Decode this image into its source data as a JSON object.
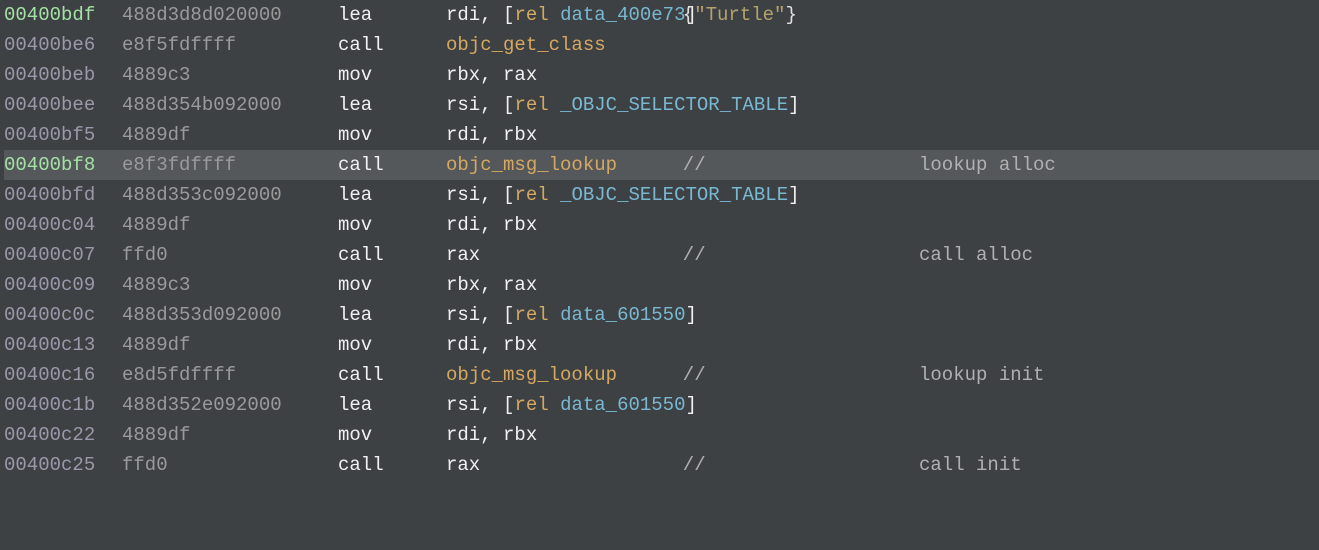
{
  "rows": [
    {
      "addr": "00400bdf",
      "addrClass": "addr",
      "bytes": "488d3d8d020000",
      "mnem": "lea",
      "ops": [
        {
          "t": "rdi",
          "c": "reg"
        },
        {
          "t": ", [",
          "c": "punct"
        },
        {
          "t": "rel",
          "c": "kw"
        },
        {
          "t": " ",
          "c": "punct"
        },
        {
          "t": "data_400e73",
          "c": "sym"
        },
        {
          "t": "]",
          "c": "punct"
        }
      ],
      "annot": [
        {
          "t": "  {",
          "c": "brace"
        },
        {
          "t": "\"Turtle\"",
          "c": "string"
        },
        {
          "t": "}",
          "c": "brace"
        }
      ]
    },
    {
      "addr": "00400be6",
      "addrClass": "addr-dim",
      "bytes": "e8f5fdffff",
      "mnem": "call",
      "ops": [
        {
          "t": "objc_get_class",
          "c": "callsym"
        }
      ]
    },
    {
      "addr": "00400beb",
      "addrClass": "addr-dim",
      "bytes": "4889c3",
      "mnem": "mov",
      "ops": [
        {
          "t": "rbx",
          "c": "reg"
        },
        {
          "t": ", ",
          "c": "punct"
        },
        {
          "t": "rax",
          "c": "reg"
        }
      ]
    },
    {
      "addr": "00400bee",
      "addrClass": "addr-dim",
      "bytes": "488d354b092000",
      "mnem": "lea",
      "ops": [
        {
          "t": "rsi",
          "c": "reg"
        },
        {
          "t": ", [",
          "c": "punct"
        },
        {
          "t": "rel",
          "c": "kw"
        },
        {
          "t": " ",
          "c": "punct"
        },
        {
          "t": "_OBJC_SELECTOR_TABLE",
          "c": "sym-selector"
        },
        {
          "t": "]",
          "c": "punct"
        }
      ]
    },
    {
      "addr": "00400bf5",
      "addrClass": "addr-dim",
      "bytes": "4889df",
      "mnem": "mov",
      "ops": [
        {
          "t": "rdi",
          "c": "reg"
        },
        {
          "t": ", ",
          "c": "punct"
        },
        {
          "t": "rbx",
          "c": "reg"
        }
      ]
    },
    {
      "addr": "00400bf8",
      "addrClass": "addr",
      "highlighted": true,
      "bytes": "e8f3fdffff",
      "mnem": "call",
      "ops": [
        {
          "t": "objc_msg_lookup",
          "c": "callsym"
        }
      ],
      "annot": [
        {
          "t": "  // ",
          "c": "comment"
        }
      ],
      "comment": [
        {
          "t": "lookup alloc",
          "c": "comment"
        }
      ]
    },
    {
      "addr": "00400bfd",
      "addrClass": "addr-dim",
      "bytes": "488d353c092000",
      "mnem": "lea",
      "ops": [
        {
          "t": "rsi",
          "c": "reg"
        },
        {
          "t": ", [",
          "c": "punct"
        },
        {
          "t": "rel",
          "c": "kw"
        },
        {
          "t": " ",
          "c": "punct"
        },
        {
          "t": "_OBJC_SELECTOR_TABLE",
          "c": "sym-selector"
        },
        {
          "t": "]",
          "c": "punct"
        }
      ]
    },
    {
      "addr": "00400c04",
      "addrClass": "addr-dim",
      "bytes": "4889df",
      "mnem": "mov",
      "ops": [
        {
          "t": "rdi",
          "c": "reg"
        },
        {
          "t": ", ",
          "c": "punct"
        },
        {
          "t": "rbx",
          "c": "reg"
        }
      ]
    },
    {
      "addr": "00400c07",
      "addrClass": "addr-dim",
      "bytes": "ffd0",
      "mnem": "call",
      "ops": [
        {
          "t": "rax",
          "c": "reg"
        }
      ],
      "annot": [
        {
          "t": "  // ",
          "c": "comment"
        }
      ],
      "comment": [
        {
          "t": "call alloc",
          "c": "comment"
        }
      ]
    },
    {
      "addr": "00400c09",
      "addrClass": "addr-dim",
      "bytes": "4889c3",
      "mnem": "mov",
      "ops": [
        {
          "t": "rbx",
          "c": "reg"
        },
        {
          "t": ", ",
          "c": "punct"
        },
        {
          "t": "rax",
          "c": "reg"
        }
      ]
    },
    {
      "addr": "00400c0c",
      "addrClass": "addr-dim",
      "bytes": "488d353d092000",
      "mnem": "lea",
      "ops": [
        {
          "t": "rsi",
          "c": "reg"
        },
        {
          "t": ", [",
          "c": "punct"
        },
        {
          "t": "rel",
          "c": "kw"
        },
        {
          "t": " ",
          "c": "punct"
        },
        {
          "t": "data_601550",
          "c": "sym"
        },
        {
          "t": "]",
          "c": "punct"
        }
      ]
    },
    {
      "addr": "00400c13",
      "addrClass": "addr-dim",
      "bytes": "4889df",
      "mnem": "mov",
      "ops": [
        {
          "t": "rdi",
          "c": "reg"
        },
        {
          "t": ", ",
          "c": "punct"
        },
        {
          "t": "rbx",
          "c": "reg"
        }
      ]
    },
    {
      "addr": "00400c16",
      "addrClass": "addr-dim",
      "bytes": "e8d5fdffff",
      "mnem": "call",
      "ops": [
        {
          "t": "objc_msg_lookup",
          "c": "callsym"
        }
      ],
      "annot": [
        {
          "t": "  // ",
          "c": "comment"
        }
      ],
      "comment": [
        {
          "t": "lookup init",
          "c": "comment"
        }
      ]
    },
    {
      "addr": "00400c1b",
      "addrClass": "addr-dim",
      "bytes": "488d352e092000",
      "mnem": "lea",
      "ops": [
        {
          "t": "rsi",
          "c": "reg"
        },
        {
          "t": ", [",
          "c": "punct"
        },
        {
          "t": "rel",
          "c": "kw"
        },
        {
          "t": " ",
          "c": "punct"
        },
        {
          "t": "data_601550",
          "c": "sym"
        },
        {
          "t": "]",
          "c": "punct"
        }
      ]
    },
    {
      "addr": "00400c22",
      "addrClass": "addr-dim",
      "bytes": "4889df",
      "mnem": "mov",
      "ops": [
        {
          "t": "rdi",
          "c": "reg"
        },
        {
          "t": ", ",
          "c": "punct"
        },
        {
          "t": "rbx",
          "c": "reg"
        }
      ]
    },
    {
      "addr": "00400c25",
      "addrClass": "addr-dim",
      "bytes": "ffd0",
      "mnem": "call",
      "ops": [
        {
          "t": "rax",
          "c": "reg"
        }
      ],
      "annot": [
        {
          "t": "  // ",
          "c": "comment"
        }
      ],
      "comment": [
        {
          "t": "call init",
          "c": "comment"
        }
      ]
    }
  ]
}
